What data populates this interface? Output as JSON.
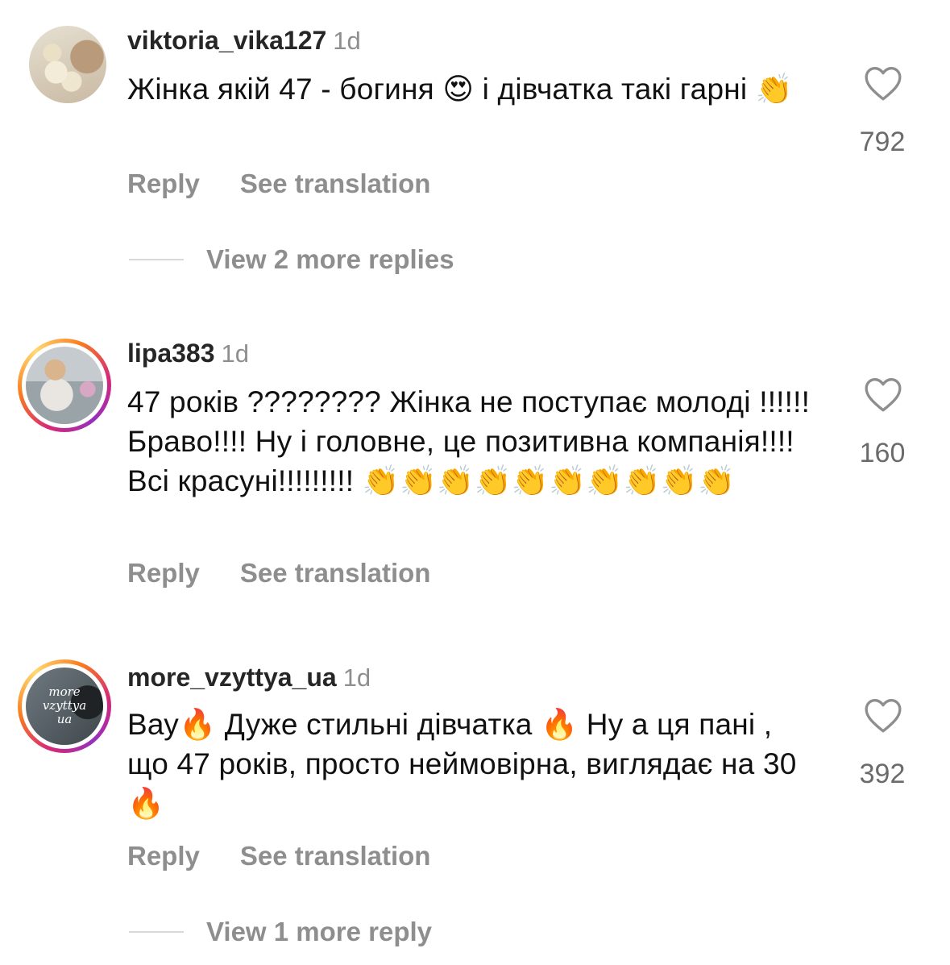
{
  "comments": [
    {
      "username": "viktoria_vika127",
      "time": "1d",
      "text": "Жінка якій 47 - богиня 😍 і дівчатка такі гарні 👏",
      "likes": "792",
      "reply_label": "Reply",
      "translate_label": "See translation",
      "more_replies": "View 2 more replies"
    },
    {
      "username": "lipa383",
      "time": "1d",
      "text": "47 років ???????? Жінка не поступає молоді !!!!!! Браво!!!! Ну і головне, це позитивна компанія!!!! Всі красуні!!!!!!!!! 👏👏👏👏👏👏👏👏👏👏",
      "likes": "160",
      "reply_label": "Reply",
      "translate_label": "See translation"
    },
    {
      "username": "more_vzyttya_ua",
      "time": "1d",
      "text": "Вау🔥 Дуже стильні дівчатка 🔥 Ну а ця пані , що 47 років, просто неймовірна, виглядає на 30 🔥",
      "likes": "392",
      "reply_label": "Reply",
      "translate_label": "See translation",
      "more_replies": "View 1 more reply",
      "avatar_text": [
        "more",
        "vzyttya",
        "ua"
      ]
    }
  ],
  "icons": {
    "like": "heart-outline-icon"
  },
  "colors": {
    "secondary_text": "#8e8e8e",
    "story_ring": [
      "#d62976",
      "#fa7e1e",
      "#feda75",
      "#962fbf"
    ]
  }
}
